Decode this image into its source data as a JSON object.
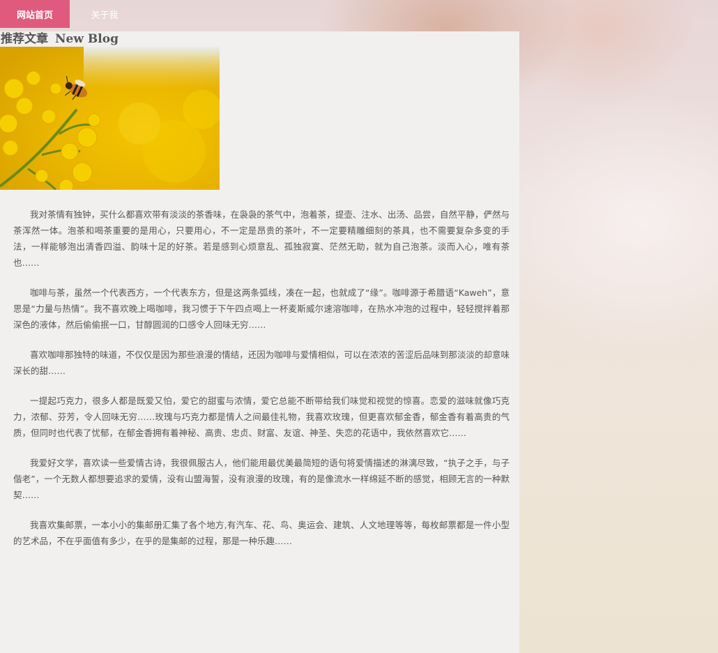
{
  "nav": {
    "items": [
      {
        "label": "网站首页",
        "active": true
      },
      {
        "label": "关于我",
        "active": false
      }
    ]
  },
  "main": {
    "heading": {
      "cn": "推荐文章",
      "en": "New Blog"
    },
    "image_icon": "bee-on-yellow-flower-photo",
    "paragraphs": [
      "我对茶情有独钟，买什么都喜欢带有淡淡的茶香味，在袅袅的茶气中，泡着茶，提壶、注水、出汤、品尝，自然平静，俨然与茶浑然一体。泡茶和喝茶重要的是用心，只要用心，不一定是昂贵的茶叶，不一定要精雕细刻的茶具，也不需要复杂多变的手法，一样能够泡出清香四溢、韵味十足的好茶。若是感到心烦意乱、孤独寂寞、茫然无助，就为自己泡茶。淡而入心，唯有茶也……",
      "咖啡与茶，虽然一个代表西方，一个代表东方，但是这两条弧线，凑在一起，也就成了“缘”。咖啡源于希腊语“Kaweh”，意思是“力量与热情”。我不喜欢晚上喝咖啡，我习惯于下午四点喝上一杯麦斯威尔速溶咖啡，在热水冲泡的过程中，轻轻搅拌着那深色的液体，然后偷偷抿一口，甘醇圆润的口感令人回味无穷……",
      "喜欢咖啡那独特的味道，不仅仅是因为那些浪漫的情结，还因为咖啡与爱情相似，可以在浓浓的苦涩后品味到那淡淡的却意味深长的甜……",
      "一提起巧克力，很多人都是既爱又怕，爱它的甜蜜与浓情，爱它总能不断带给我们味觉和视觉的惊喜。恋爱的滋味就像巧克力，浓郁、芬芳，令人回味无穷……玫瑰与巧克力都是情人之间最佳礼物，我喜欢玫瑰，但更喜欢郁金香，郁金香有着高贵的气质，但同时也代表了忧郁，在郁金香拥有着神秘、高贵、忠贞、财富、友谊、神圣、失恋的花语中，我依然喜欢它……",
      "我爱好文学，喜欢读一些爱情古诗，我很佩服古人，他们能用最优美最简短的语句将爱情描述的淋漓尽致，“执子之手，与子偕老”，一个无数人都想要追求的爱情，没有山盟海誓，没有浪漫的玫瑰，有的是像流水一样绵延不断的感觉，相顾无言的一种默契……",
      "我喜欢集邮票，一本小小的集邮册汇集了各个地方,有汽车、花、鸟、奥运会、建筑、人文地理等等，每枚邮票都是一件小型的艺术品，不在乎面值有多少，在乎的是集邮的过程，那是一种乐趣……"
    ]
  }
}
